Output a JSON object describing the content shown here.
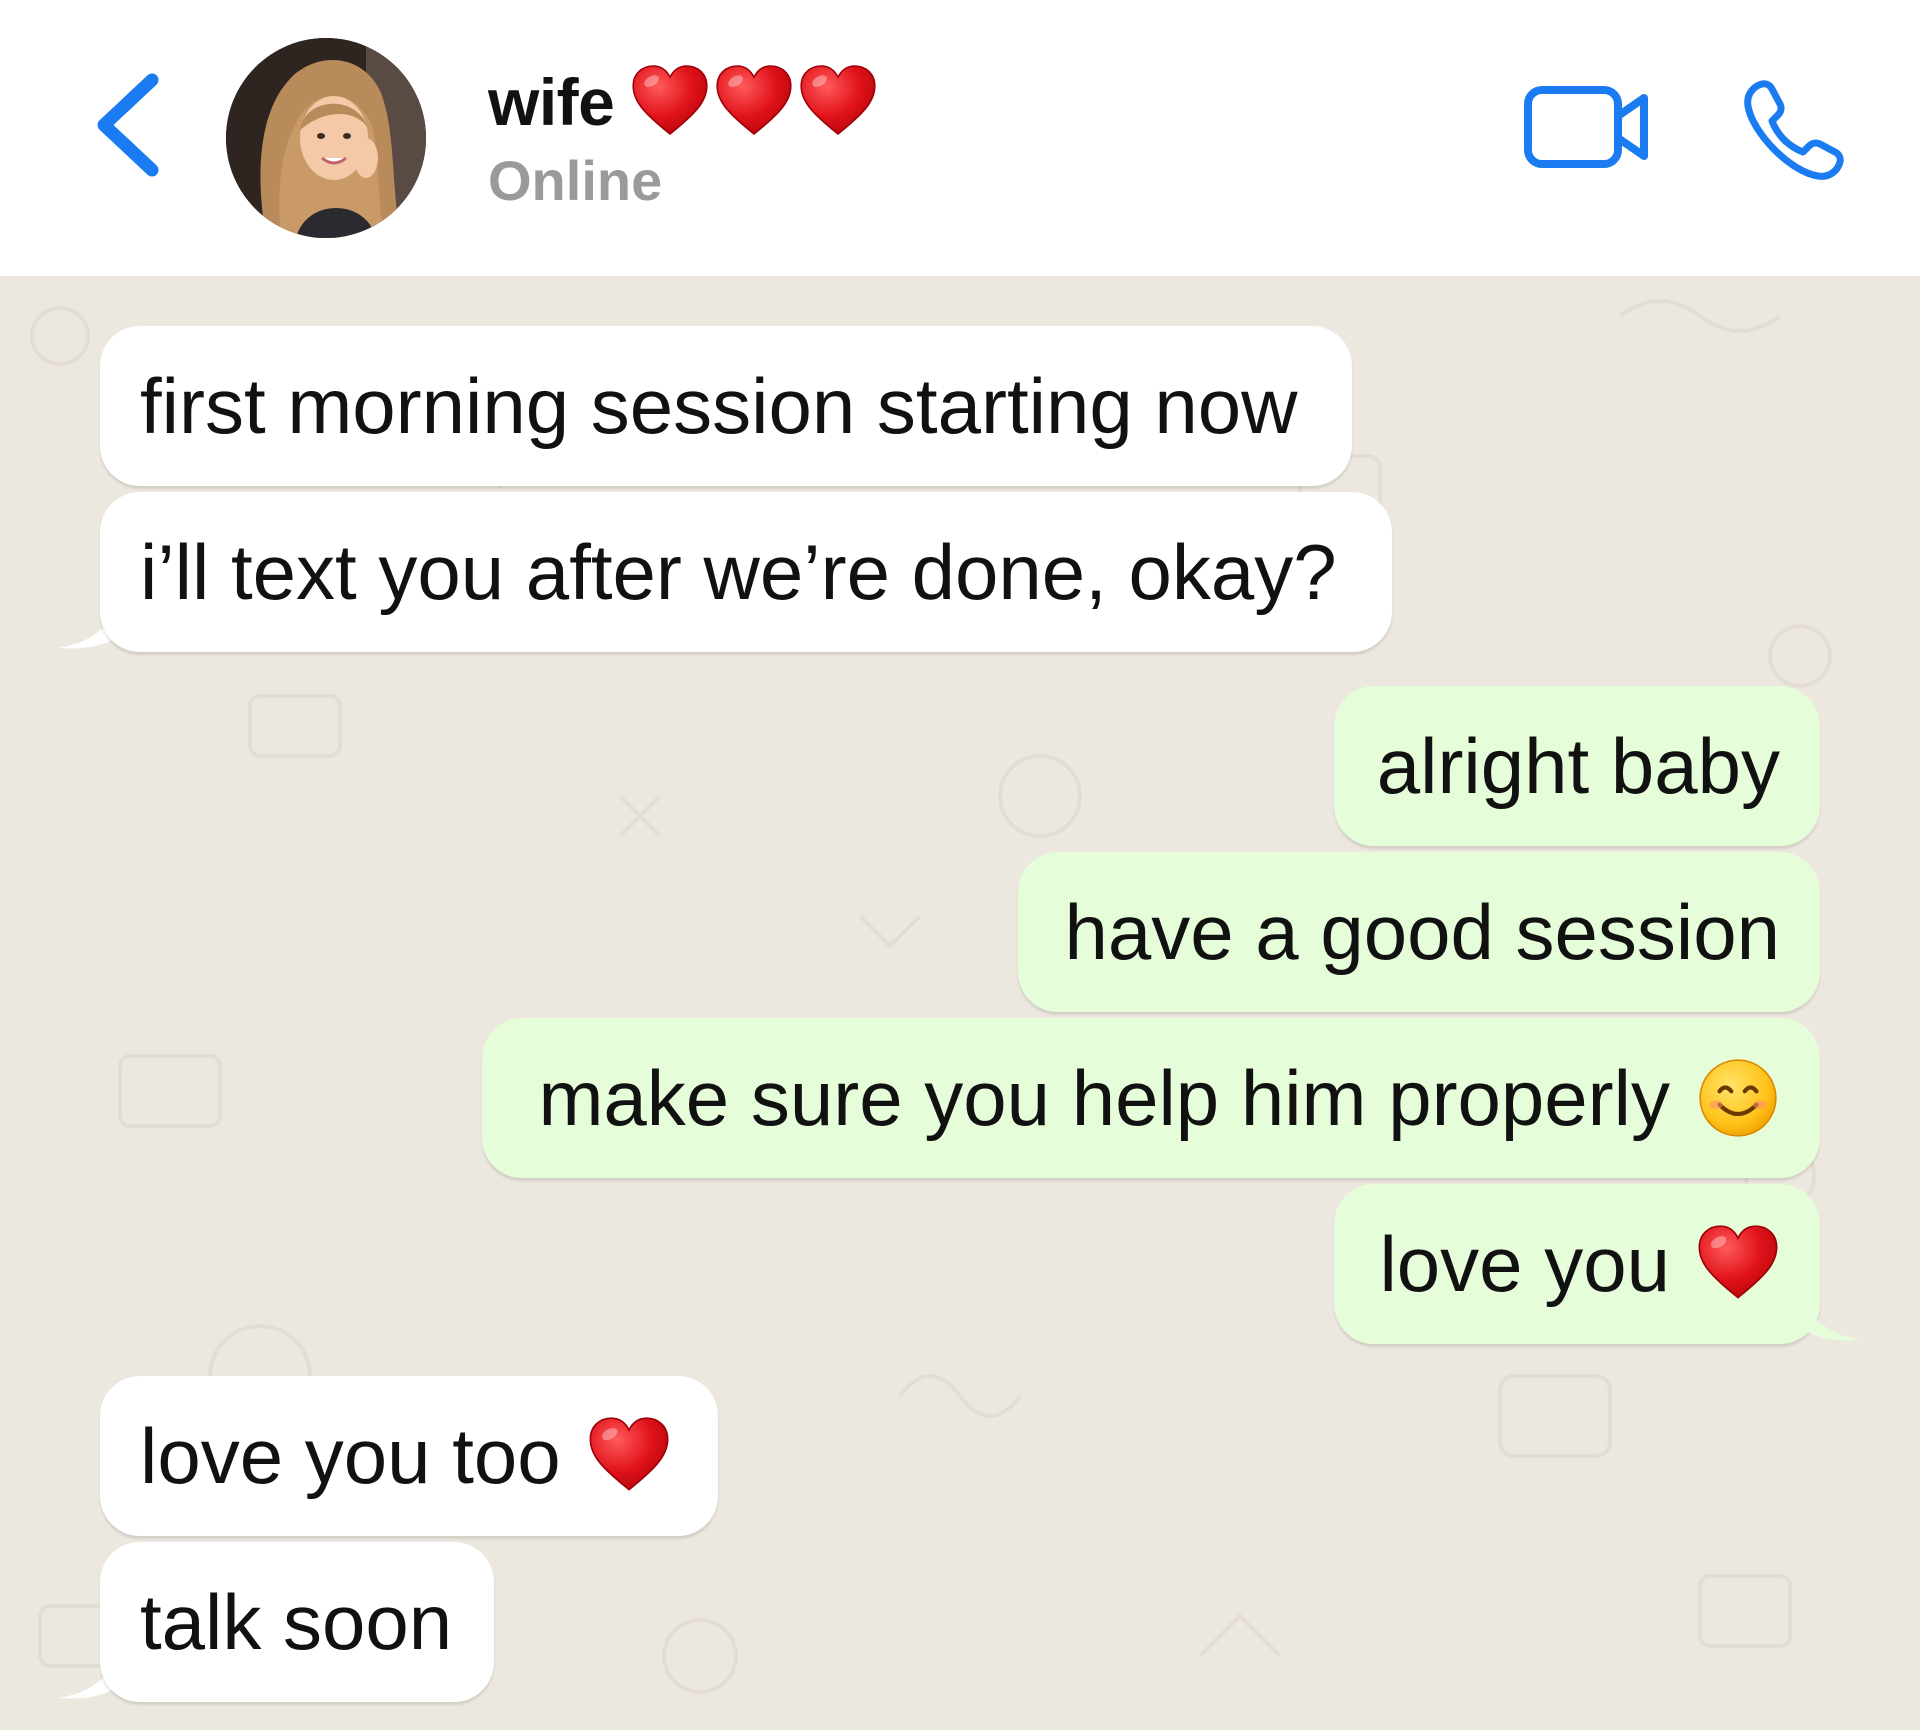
{
  "header": {
    "contact_name": "wife",
    "status": "Online",
    "name_emoji": "red-heart x3"
  },
  "messages": [
    {
      "side": "incoming",
      "text": "first morning session starting now"
    },
    {
      "side": "incoming",
      "text": "i’ll text you after we’re done, okay?"
    },
    {
      "side": "outgoing",
      "text": "alright baby"
    },
    {
      "side": "outgoing",
      "text": "have a good session"
    },
    {
      "side": "outgoing",
      "text": "make sure you help him properly",
      "emoji": "smiling-face"
    },
    {
      "side": "outgoing",
      "text": "love you",
      "emoji": "red-heart"
    },
    {
      "side": "incoming",
      "text": "love you too",
      "emoji": "red-heart"
    },
    {
      "side": "incoming",
      "text": "talk soon"
    }
  ],
  "colors": {
    "accent": "#1a7cf0",
    "chat_background": "#ece7df",
    "incoming_bubble": "#ffffff",
    "outgoing_bubble": "#e6fdd9",
    "status_text": "#9a9a9a"
  },
  "icons": [
    "back-chevron-icon",
    "video-camera-icon",
    "phone-icon"
  ]
}
